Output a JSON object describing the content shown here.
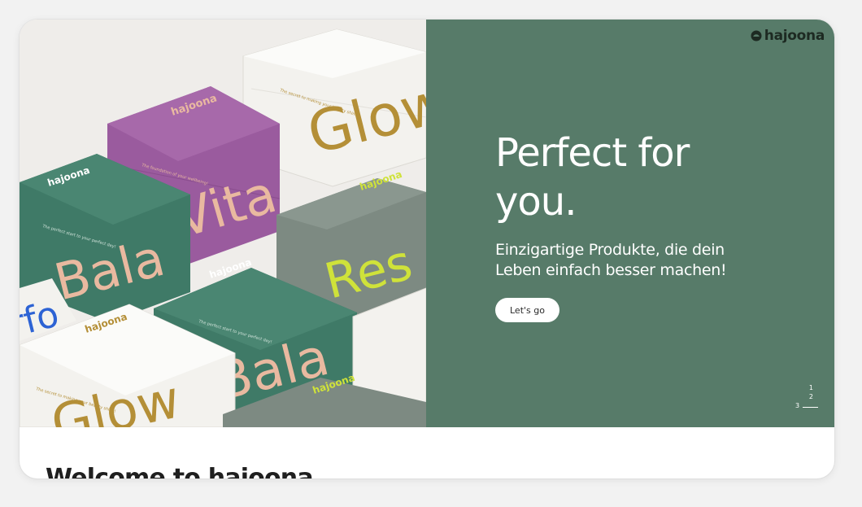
{
  "brand": {
    "name": "hajoona",
    "logo_color": "#1d2a22"
  },
  "hero": {
    "headline_line1": "Perfect for",
    "headline_line2": "you.",
    "subline_line1": "Einzigartige Produkte, die dein",
    "subline_line2": "Leben einfach besser machen!",
    "cta_label": "Let's go",
    "panel_color": "#577b69",
    "pager": [
      "1",
      "2",
      "3"
    ],
    "pager_active": "3"
  },
  "product_image": {
    "description_icon": "product-boxes-photo",
    "brand": "hajoona",
    "words": [
      "Glow",
      "Vita",
      "Bala",
      "Res",
      "Bala",
      "Glow",
      "rfo"
    ],
    "colors": {
      "green": "#3f7a67",
      "purple": "#9a5b9e",
      "grey": "#7d8a82",
      "white": "#f3f2ee",
      "gold": "#b48f37",
      "peach": "#e9b9a0",
      "lime": "#cfe23a",
      "blue": "#2d63d4"
    },
    "taglines": [
      "The secret to making your beauty shine!",
      "The foundation of your wellbeing!",
      "The perfect start to your perfect day!",
      "The perfect start to your perfect day!",
      "The secret to making your beauty shine!"
    ]
  },
  "welcome": {
    "title": "Welcome to hajoona"
  }
}
